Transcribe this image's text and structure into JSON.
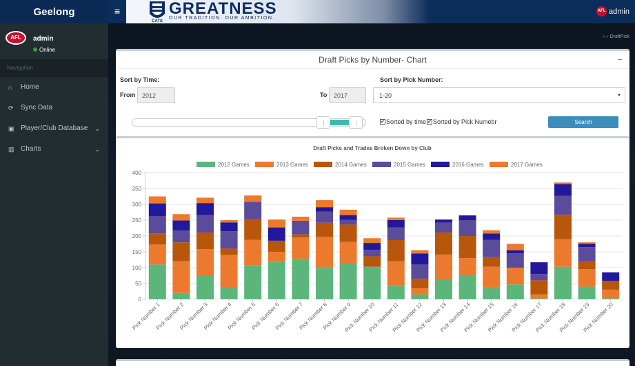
{
  "header": {
    "brand": "Geelong",
    "menu_icon": "hamburger-icon",
    "banner_logo_text": "CATS",
    "banner_title": "GREATNESS",
    "banner_subtitle": "OUR TRADITION. OUR AMBITION.",
    "user_badge": "AFL",
    "user_name": "admin"
  },
  "sidebar": {
    "logo_text": "AFL",
    "user_name": "admin",
    "status": "Online",
    "nav_header": "Navigation",
    "items": [
      {
        "label": "Home",
        "icon": "home-icon",
        "glyph": "⌂"
      },
      {
        "label": "Sync Data",
        "icon": "sync-icon",
        "glyph": "⟳"
      },
      {
        "label": "Player/Club Database",
        "icon": "id-card-icon",
        "glyph": "▣"
      },
      {
        "label": "Charts",
        "icon": "bar-chart-icon",
        "glyph": "▥"
      }
    ]
  },
  "breadcrumb": {
    "home": "⌂",
    "sep": "›",
    "current": "DraftPick"
  },
  "filters": {
    "title": "Draft Picks by Number- Chart",
    "collapse": "−",
    "sort_time_label": "Sort by Time:",
    "from_label": "From",
    "from_value": "2012",
    "to_label": "To",
    "to_value": "2017",
    "sort_pick_label": "Sort by Pick Number:",
    "pick_value": "1-20",
    "slider_low": 0.82,
    "slider_high": 0.96,
    "chk_time_label": "Sorted by time",
    "chk_pick_label": "Sorted by Pick Numebr",
    "chk_mark": "✔",
    "search_label": "Search"
  },
  "chart_data": {
    "type": "bar",
    "stacked": true,
    "title": "Draft Picks and Trades Broken Down by Club",
    "xlabel": "",
    "ylabel": "",
    "ylim": [
      0,
      400
    ],
    "yticks": [
      0,
      50,
      100,
      150,
      200,
      250,
      300,
      350,
      400
    ],
    "grid": true,
    "legend": "top",
    "categories": [
      "Pick Number 1",
      "Pick Number 2",
      "Pick Number 3",
      "Pick Number 4",
      "Pick Number 5",
      "Pick Number 6",
      "Pick Number 7",
      "Pick Number 8",
      "Pick Number 9",
      "Pick Number 10",
      "Pick Number 11",
      "Pick Number 12",
      "Pick Number 13",
      "Pick Number 14",
      "Pick Number 15",
      "Pick Number 16",
      "Pick Number 17",
      "Pick Number 18",
      "Pick Number 19",
      "Pick Number 20"
    ],
    "series": [
      {
        "name": "2012 Games",
        "color": "#5cb67c",
        "values": [
          110,
          20,
          75,
          38,
          108,
          118,
          128,
          102,
          113,
          103,
          43,
          15,
          62,
          77,
          35,
          47,
          3,
          103,
          40,
          3
        ]
      },
      {
        "name": "2013 Games",
        "color": "#ec7a2e",
        "values": [
          63,
          100,
          83,
          102,
          80,
          32,
          67,
          95,
          68,
          0,
          77,
          20,
          79,
          53,
          68,
          53,
          12,
          87,
          55,
          27
        ]
      },
      {
        "name": "2014 Games",
        "color": "#b8570b",
        "values": [
          35,
          60,
          53,
          20,
          65,
          35,
          10,
          45,
          55,
          33,
          67,
          30,
          70,
          70,
          30,
          0,
          45,
          77,
          25,
          28
        ]
      },
      {
        "name": "2015 Games",
        "color": "#5a4b9b",
        "values": [
          55,
          37,
          55,
          55,
          55,
          0,
          43,
          35,
          15,
          20,
          40,
          45,
          31,
          50,
          55,
          45,
          20,
          60,
          45,
          0
        ]
      },
      {
        "name": "2016 Games",
        "color": "#22189b",
        "values": [
          40,
          32,
          38,
          28,
          0,
          42,
          0,
          14,
          15,
          22,
          23,
          35,
          10,
          15,
          20,
          10,
          37,
          37,
          10,
          27
        ]
      },
      {
        "name": "2017 Games",
        "color": "#ec7a2e",
        "values": [
          22,
          20,
          17,
          7,
          20,
          25,
          13,
          22,
          17,
          15,
          8,
          10,
          0,
          0,
          10,
          20,
          0,
          5,
          5,
          0
        ]
      }
    ]
  }
}
